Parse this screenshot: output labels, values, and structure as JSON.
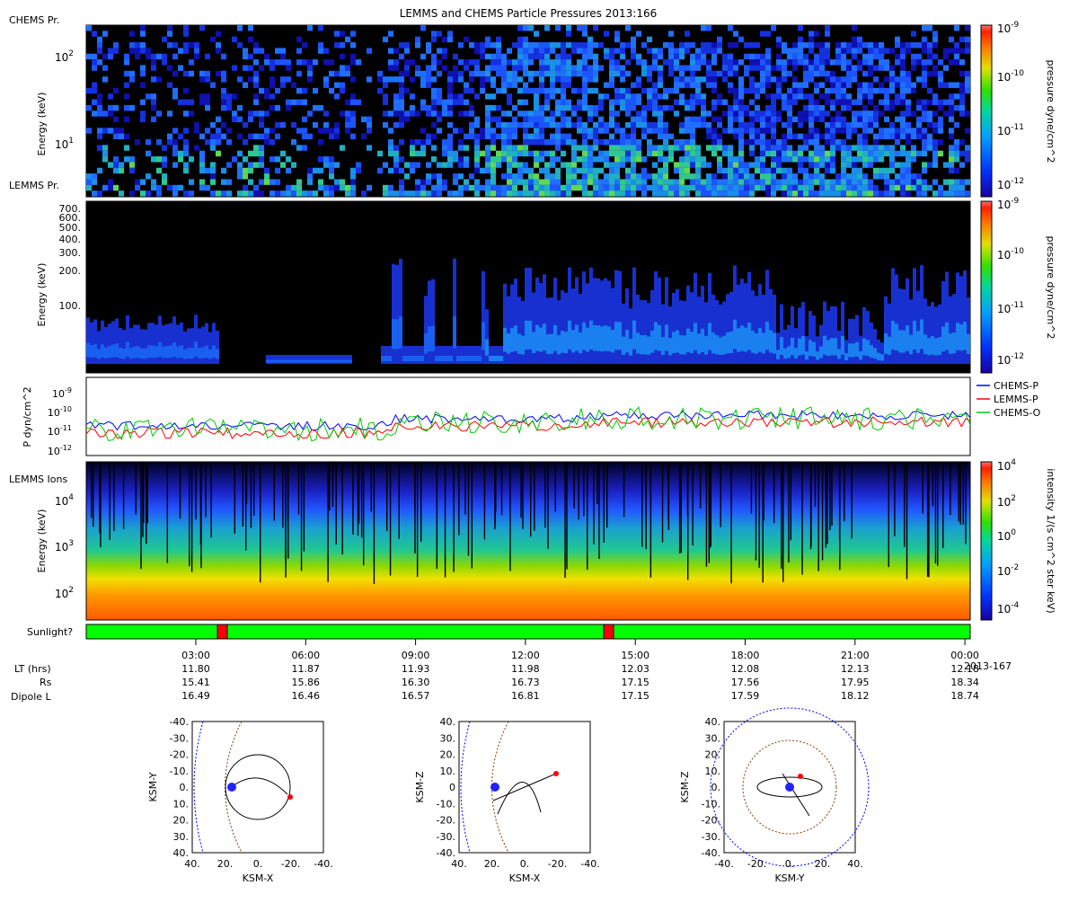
{
  "title": "LEMMS and CHEMS Particle Pressures  2013:166",
  "panels": {
    "chems": {
      "label": "CHEMS Pr.",
      "ylabel": "Energy (keV)",
      "ticks": [
        {
          "v": 10,
          "label": "10"
        },
        {
          "v": 100,
          "label": "10"
        }
      ],
      "tick_sup": [
        "1",
        "2"
      ],
      "colorbar_label": "pressure dyne/cm^2",
      "colorbar_ticks": [
        "10",
        "10",
        "10",
        "10"
      ],
      "colorbar_sup": [
        "-9",
        "-10",
        "-11",
        "-12"
      ]
    },
    "lemms_pr": {
      "label": "LEMMS Pr.",
      "ylabel": "Energy (keV)",
      "ticks": [
        "700.",
        "600.",
        "500.",
        "400.",
        "300.",
        "200.",
        "100."
      ],
      "colorbar_label": "pressure dyne/cm^2",
      "colorbar_ticks": [
        "10",
        "10",
        "10",
        "10"
      ],
      "colorbar_sup": [
        "-9",
        "-10",
        "-11",
        "-12"
      ]
    },
    "pressure": {
      "ylabel": "P dyn/cm^2",
      "ticks": [
        "10",
        "10",
        "10",
        "10"
      ],
      "tick_sup": [
        "-9",
        "-10",
        "-11",
        "-12"
      ],
      "legend": [
        {
          "name": "CHEMS-P",
          "color": "#0000ff"
        },
        {
          "name": "LEMMS-P",
          "color": "#ff0000"
        },
        {
          "name": "CHEMS-O",
          "color": "#00cc00"
        }
      ]
    },
    "lemms_ions": {
      "label": "LEMMS Ions",
      "ylabel": "Energy (keV)",
      "ticks": [
        "10",
        "10",
        "10"
      ],
      "tick_sup": [
        "4",
        "3",
        "2"
      ],
      "colorbar_label": "intensity 1/(s cm^2 ster keV)",
      "colorbar_ticks": [
        "10",
        "10",
        "10",
        "10",
        "10"
      ],
      "colorbar_sup": [
        "4",
        "2",
        "0",
        "-2",
        "-4"
      ]
    },
    "sunlight": {
      "label": "Sunlight?",
      "color_lit": "#00ff00",
      "color_dark": "#ff0000"
    }
  },
  "time_axis": {
    "ticks": [
      "03:00",
      "06:00",
      "09:00",
      "12:00",
      "15:00",
      "18:00",
      "21:00",
      "00:00"
    ],
    "end_label": "2013-167",
    "rows": [
      {
        "label": "LT (hrs)",
        "values": [
          "11.80",
          "11.87",
          "11.93",
          "11.98",
          "12.03",
          "12.08",
          "12.13",
          "12.18"
        ]
      },
      {
        "label": "Rs",
        "values": [
          "15.41",
          "15.86",
          "16.30",
          "16.73",
          "17.15",
          "17.56",
          "17.95",
          "18.34"
        ]
      },
      {
        "label": "Dipole L",
        "values": [
          "16.49",
          "16.46",
          "16.57",
          "16.81",
          "17.15",
          "17.59",
          "18.12",
          "18.74"
        ]
      }
    ]
  },
  "orbits": [
    {
      "xlabel": "KSM-X",
      "ylabel": "KSM-Y",
      "xticks": [
        "40.",
        "20.",
        "0.",
        "-20.",
        "-40."
      ],
      "yticks": [
        "-40.",
        "-30.",
        "-20.",
        "-10.",
        "0.",
        "10.",
        "20.",
        "30.",
        "40."
      ]
    },
    {
      "xlabel": "KSM-X",
      "ylabel": "KSM-Z",
      "xticks": [
        "40.",
        "20.",
        "0.",
        "-20.",
        "-40."
      ],
      "yticks": [
        "40.",
        "30.",
        "20.",
        "10.",
        "0",
        "-10.",
        "-20.",
        "-30.",
        "-40."
      ]
    },
    {
      "xlabel": "KSM-Y",
      "ylabel": "KSM-Z",
      "xticks": [
        "-40.",
        "-20.",
        "0.",
        "20.",
        "40."
      ],
      "yticks": [
        "40.",
        "30.",
        "20.",
        "10.",
        "0.",
        "-10.",
        "-20.",
        "-30.",
        "-40."
      ]
    }
  ],
  "chart_data": [
    {
      "type": "heatmap",
      "title": "LEMMS and CHEMS Particle Pressures  2013:166",
      "ylabel": "Energy (keV)",
      "yscale": "log",
      "colorbar": "pressure dyne/cm^2",
      "crange": [
        "1e-12",
        "1e-9"
      ]
    },
    {
      "type": "heatmap",
      "ylabel": "Energy (keV)",
      "colorbar": "pressure dyne/cm^2",
      "crange": [
        "1e-12",
        "1e-9"
      ]
    },
    {
      "type": "line",
      "ylabel": "P dyn/cm^2",
      "yscale": "log",
      "ylim": [
        "1e-12",
        "1e-9"
      ],
      "series": [
        {
          "name": "CHEMS-P"
        },
        {
          "name": "LEMMS-P"
        },
        {
          "name": "CHEMS-O"
        }
      ]
    },
    {
      "type": "heatmap",
      "ylabel": "Energy (keV)",
      "yscale": "log",
      "colorbar": "intensity 1/(s cm^2 ster keV)",
      "crange": [
        "1e-4",
        "1e4"
      ]
    }
  ]
}
